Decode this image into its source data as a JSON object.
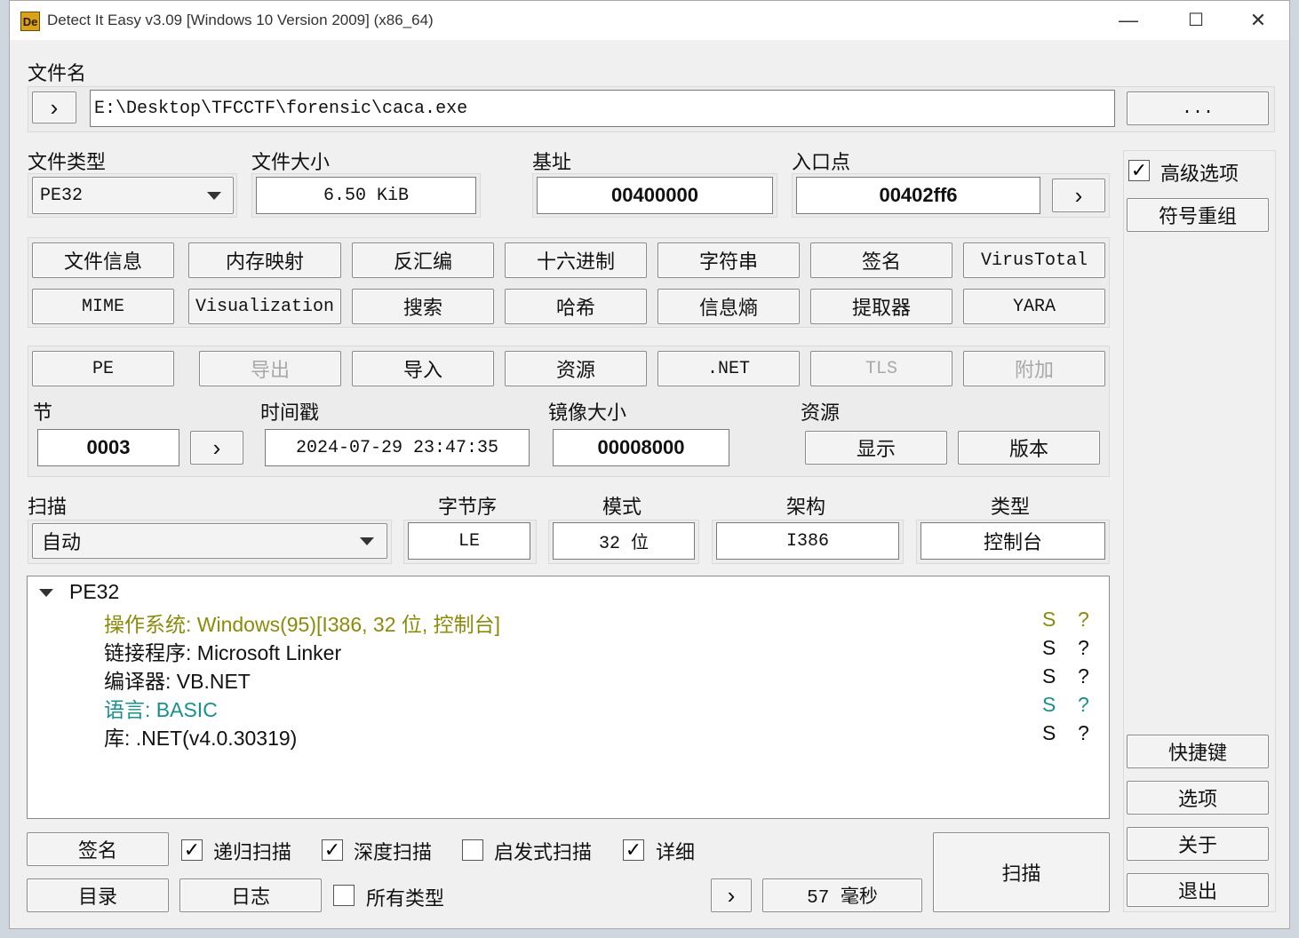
{
  "window": {
    "icon_text": "De",
    "title": "Detect It Easy v3.09 [Windows 10 Version 2009] (x86_64)",
    "minimize": "—",
    "maximize": "☐",
    "close": "✕"
  },
  "file": {
    "label": "文件名",
    "nav": "›",
    "path": "E:\\Desktop\\TFCCTF\\forensic\\caca.exe",
    "browse": "..."
  },
  "info": {
    "filetype_label": "文件类型",
    "filetype_value": "PE32",
    "filesize_label": "文件大小",
    "filesize_value": "6.50 KiB",
    "base_label": "基址",
    "base_value": "00400000",
    "entry_label": "入口点",
    "entry_value": "00402ff6",
    "entry_nav": "›"
  },
  "side": {
    "advanced_label": "高级选项",
    "advanced_checked": "✓",
    "demangle": "符号重组",
    "shortcuts": "快捷键",
    "options": "选项",
    "about": "关于",
    "exit": "退出"
  },
  "tools": {
    "row1": [
      "文件信息",
      "内存映射",
      "反汇编",
      "十六进制",
      "字符串",
      "签名",
      "VirusTotal"
    ],
    "row2": [
      "MIME",
      "Visualization",
      "搜索",
      "哈希",
      "信息熵",
      "提取器",
      "YARA"
    ]
  },
  "pe": {
    "buttons": [
      "PE",
      "导出",
      "导入",
      "资源",
      ".NET",
      "TLS",
      "附加"
    ],
    "sections_label": "节",
    "sections_value": "0003",
    "sections_nav": "›",
    "timestamp_label": "时间戳",
    "timestamp_value": "2024-07-29 23:47:35",
    "imagesize_label": "镜像大小",
    "imagesize_value": "00008000",
    "resources_label": "资源",
    "show": "显示",
    "version": "版本"
  },
  "scan": {
    "label": "扫描",
    "mode_value": "自动",
    "endian_label": "字节序",
    "endian_value": "LE",
    "mode_label": "模式",
    "bits_value": "32 位",
    "arch_label": "架构",
    "arch_value": "I386",
    "type_label": "类型",
    "type_value": "控制台"
  },
  "results": {
    "root": "PE32",
    "rows": [
      {
        "text": "操作系统: Windows(95)[I386, 32 位, 控制台]",
        "s": "S",
        "q": "?",
        "color": "#8b8b0a"
      },
      {
        "text": "链接程序: Microsoft Linker",
        "s": "S",
        "q": "?",
        "color": "#111111"
      },
      {
        "text": "编译器: VB.NET",
        "s": "S",
        "q": "?",
        "color": "#111111"
      },
      {
        "text": "语言: BASIC",
        "s": "S",
        "q": "?",
        "color": "#18908c"
      },
      {
        "text": "库: .NET(v4.0.30319)",
        "s": "S",
        "q": "?",
        "color": "#111111"
      }
    ]
  },
  "bottom": {
    "signatures": "签名",
    "recursive": "递归扫描",
    "recursive_checked": "✓",
    "deep": "深度扫描",
    "deep_checked": "✓",
    "heuristic": "启发式扫描",
    "heuristic_checked": "",
    "verbose": "详细",
    "verbose_checked": "✓",
    "directory": "目录",
    "log": "日志",
    "alltypes": "所有类型",
    "alltypes_checked": "",
    "nav": "›",
    "elapsed": "57 毫秒",
    "scan": "扫描"
  }
}
